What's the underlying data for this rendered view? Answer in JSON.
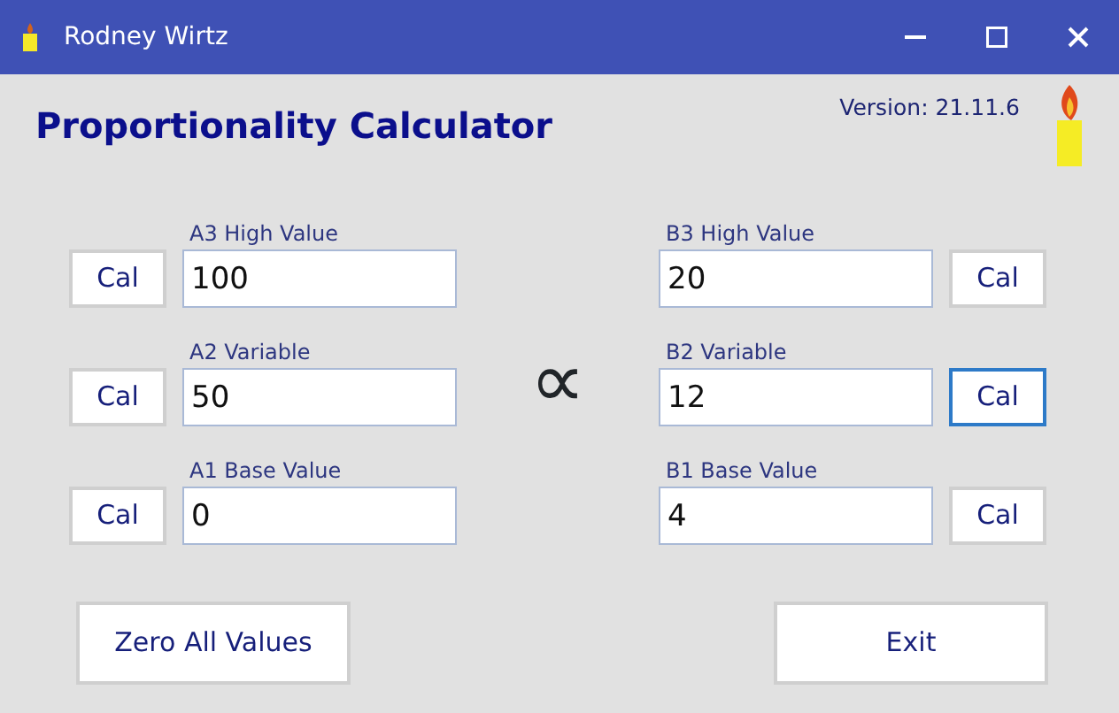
{
  "window": {
    "title": "Rodney Wirtz"
  },
  "header": {
    "title": "Proportionality Calculator",
    "version": "Version: 21.11.6"
  },
  "proportional_symbol": "∝",
  "rows": [
    {
      "left": {
        "label": "A3 High Value",
        "value": "100",
        "button": "Cal",
        "focused": false
      },
      "right": {
        "label": "B3 High Value",
        "value": "20",
        "button": "Cal",
        "focused": false
      }
    },
    {
      "left": {
        "label": "A2 Variable",
        "value": "50",
        "button": "Cal",
        "focused": false
      },
      "right": {
        "label": "B2 Variable",
        "value": "12",
        "button": "Cal",
        "focused": true
      }
    },
    {
      "left": {
        "label": "A1 Base Value",
        "value": "0",
        "button": "Cal",
        "focused": false
      },
      "right": {
        "label": "B1 Base Value",
        "value": "4",
        "button": "Cal",
        "focused": false
      }
    }
  ],
  "buttons": [
    "Zero All Values",
    "Exit"
  ]
}
